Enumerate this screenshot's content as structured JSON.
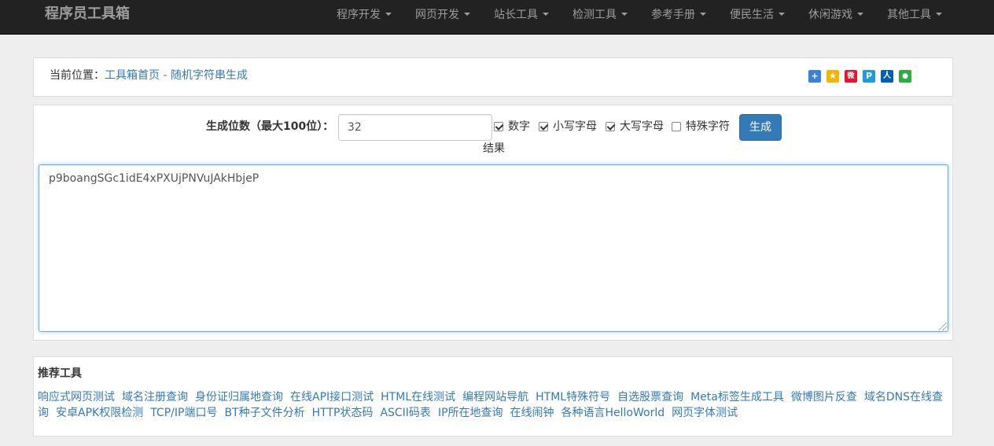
{
  "navbar": {
    "brand": "程序员工具箱",
    "items": [
      {
        "label": "程序开发"
      },
      {
        "label": "网页开发"
      },
      {
        "label": "站长工具"
      },
      {
        "label": "检测工具"
      },
      {
        "label": "参考手册"
      },
      {
        "label": "便民生活"
      },
      {
        "label": "休闲游戏"
      },
      {
        "label": "其他工具"
      }
    ]
  },
  "breadcrumb": {
    "prefix": "当前位置：",
    "home_link": "工具箱首页",
    "separator": " - ",
    "current_link": "随机字符串生成"
  },
  "share": {
    "icons": [
      {
        "name": "share-plus-icon",
        "glyph": "+",
        "color": "#3b82d6"
      },
      {
        "name": "qzone-icon",
        "glyph": "★",
        "color": "#f5b400"
      },
      {
        "name": "weibo-icon",
        "glyph": "微",
        "color": "#e6162d"
      },
      {
        "name": "tencent-weibo-icon",
        "glyph": "P",
        "color": "#1c9dd9"
      },
      {
        "name": "renren-icon",
        "glyph": "人",
        "color": "#005eac"
      },
      {
        "name": "wechat-icon",
        "glyph": "●",
        "color": "#2aae40"
      }
    ]
  },
  "tool": {
    "length_label": "生成位数（最大100位）：",
    "length_value": "32",
    "options": [
      {
        "label": "数字",
        "checked": true
      },
      {
        "label": "小写字母",
        "checked": true
      },
      {
        "label": "大写字母",
        "checked": true
      },
      {
        "label": "特殊字符",
        "checked": false
      }
    ],
    "generate_button": "生成",
    "result_label": "结果",
    "result_value": "p9boangSGc1idE4xPXUjPNVuJAkHbjeP"
  },
  "recommend": {
    "title": "推荐工具",
    "links": [
      "响应式网页测试",
      "域名注册查询",
      "身份证归属地查询",
      "在线API接口测试",
      "HTML在线测试",
      "编程网站导航",
      "HTML特殊符号",
      "自选股票查询",
      "Meta标签生成工具",
      "微博图片反查",
      "域名DNS在线查询",
      "安卓APK权限检测",
      "TCP/IP端口号",
      "BT种子文件分析",
      "HTTP状态码",
      "ASCII码表",
      "IP所在地查询",
      "在线闹钟",
      "各种语言HelloWorld",
      "网页字体测试"
    ]
  }
}
